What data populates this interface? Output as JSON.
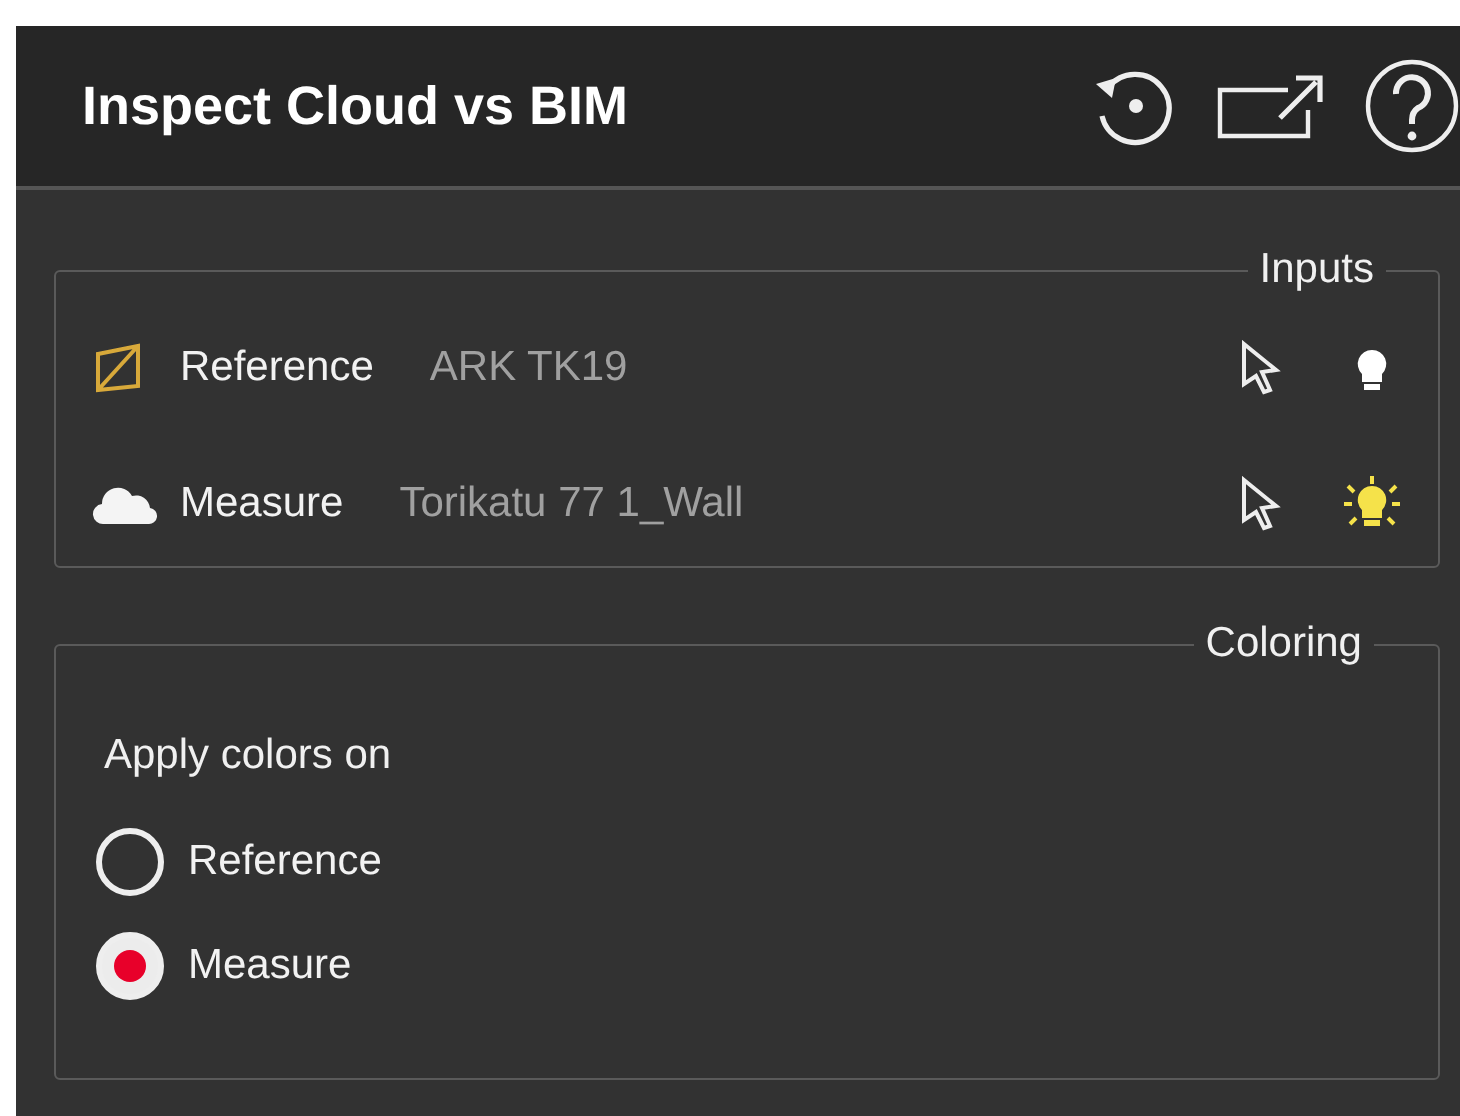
{
  "window": {
    "title": "Inspect Cloud vs BIM"
  },
  "inputs": {
    "legend": "Inputs",
    "items": [
      {
        "kind": "model",
        "label": "Reference",
        "value": "ARK TK19",
        "lit": false
      },
      {
        "kind": "cloud",
        "label": "Measure",
        "value": "Torikatu 77 1_Wall",
        "lit": true
      }
    ]
  },
  "coloring": {
    "legend": "Coloring",
    "prompt": "Apply colors on",
    "options": [
      {
        "label": "Reference",
        "selected": false
      },
      {
        "label": "Measure",
        "selected": true
      }
    ]
  }
}
